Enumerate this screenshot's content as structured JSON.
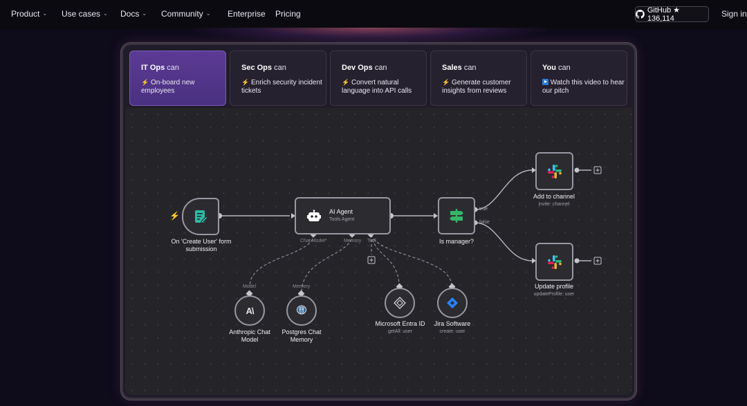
{
  "nav": {
    "items": [
      {
        "label": "Product",
        "has_dropdown": true
      },
      {
        "label": "Use cases",
        "has_dropdown": true
      },
      {
        "label": "Docs",
        "has_dropdown": true
      },
      {
        "label": "Community",
        "has_dropdown": true
      },
      {
        "label": "Enterprise",
        "has_dropdown": false
      },
      {
        "label": "Pricing",
        "has_dropdown": false
      }
    ],
    "github_label": "GitHub ★ 136,114",
    "signin_label": "Sign in"
  },
  "tabs": [
    {
      "role": "IT Ops",
      "can": "can",
      "icon": "bolt-icon",
      "desc": "On-board new employees",
      "active": true
    },
    {
      "role": "Sec Ops",
      "can": "can",
      "icon": "bolt-icon",
      "desc": "Enrich security incident tickets",
      "active": false
    },
    {
      "role": "Dev Ops",
      "can": "can",
      "icon": "bolt-icon",
      "desc": "Convert natural language into API calls",
      "active": false
    },
    {
      "role": "Sales",
      "can": "can",
      "icon": "bolt-icon",
      "desc": "Generate customer insights from reviews",
      "active": false
    },
    {
      "role": "You",
      "can": "can",
      "icon": "play-icon",
      "desc": "Watch this video to hear our pitch",
      "active": false
    }
  ],
  "workflow": {
    "trigger": {
      "label": "On 'Create User' form submission",
      "icon": "form-icon"
    },
    "agent": {
      "title": "AI Agent",
      "subtitle": "Tools Agent",
      "icon": "robot-icon",
      "ports": {
        "chat_model": "Chat Model*",
        "memory": "Memory",
        "tool": "Tool"
      }
    },
    "condition": {
      "label": "Is manager?",
      "icon": "signpost-icon",
      "true_label": "true",
      "false_label": "false"
    },
    "slack_top": {
      "label": "Add to channel",
      "sub": "invite: channel",
      "icon": "slack-icon"
    },
    "slack_bottom": {
      "label": "Update profile",
      "sub": "updateProfile: user",
      "icon": "slack-icon"
    },
    "model": {
      "label": "Anthropic Chat Model",
      "port": "Model",
      "icon": "anthropic-icon"
    },
    "memory": {
      "label": "Postgres Chat Memory",
      "port": "Memory",
      "icon": "postgres-icon"
    },
    "entra": {
      "label": "Microsoft Entra ID",
      "sub": "getAll: user",
      "icon": "entra-icon"
    },
    "jira": {
      "label": "Jira Software",
      "sub": "create: user",
      "icon": "jira-icon"
    }
  },
  "colors": {
    "accent_purple": "#5b3a94",
    "background": "#0e0b1b",
    "canvas": "#252429",
    "trigger_bolt": "#ff6d5a",
    "form_icon": "#2fb8a6",
    "signpost_icon": "#35b56a",
    "jira_blue": "#2684ff"
  }
}
